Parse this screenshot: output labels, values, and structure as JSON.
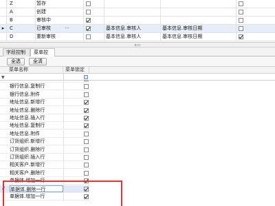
{
  "top_grid": {
    "rows": [
      {
        "code": "Z",
        "name": "暂存",
        "chk1": false,
        "f1": "",
        "f2": "",
        "chk2": false,
        "indicator": "",
        "selected": false
      },
      {
        "code": "A",
        "name": "创建",
        "chk1": false,
        "f1": "",
        "f2": "",
        "chk2": false,
        "indicator": "",
        "selected": false
      },
      {
        "code": "B",
        "name": "审核中",
        "chk1": true,
        "f1": "",
        "f2": "",
        "chk2": false,
        "indicator": "",
        "selected": false
      },
      {
        "code": "C",
        "name": "已审核",
        "chk1": true,
        "f1": "基本信息.审核人",
        "f2": "基本信息.审核日期",
        "chk2": false,
        "indicator": "▸",
        "selected": true,
        "dots": "···"
      },
      {
        "code": "D",
        "name": "重新审核",
        "chk1": false,
        "f1": "基本信息.审核人",
        "f2": "基本信息.审核日期",
        "chk2": true,
        "indicator": "",
        "selected": false
      }
    ]
  },
  "tabs": [
    {
      "label": "字段控制"
    },
    {
      "label": "菜单控制"
    }
  ],
  "toolbar": {
    "select_all": "全选",
    "clear_all": "全清"
  },
  "lower_grid": {
    "headers": {
      "name": "菜单名称",
      "lock": "菜单锁定"
    },
    "filter_icon": "▼",
    "rows": [
      {
        "name": "",
        "lock": true,
        "indicator": ""
      },
      {
        "name": "银行信息.复制行",
        "lock": false,
        "indicator": ""
      },
      {
        "name": "银行信息.附件",
        "lock": false,
        "indicator": ""
      },
      {
        "name": "地址信息.新增行",
        "lock": true,
        "indicator": ""
      },
      {
        "name": "地址信息.删除行",
        "lock": true,
        "indicator": ""
      },
      {
        "name": "地址信息.插入行",
        "lock": true,
        "indicator": ""
      },
      {
        "name": "地址信息.复制行",
        "lock": true,
        "indicator": ""
      },
      {
        "name": "地址信息.附件",
        "lock": false,
        "indicator": ""
      },
      {
        "name": "订货组织.新增行",
        "lock": false,
        "indicator": ""
      },
      {
        "name": "订货组织.删除行",
        "lock": false,
        "indicator": ""
      },
      {
        "name": "订货组织.插入行",
        "lock": false,
        "indicator": ""
      },
      {
        "name": "相关客户.新增行",
        "lock": false,
        "indicator": ""
      },
      {
        "name": "相关客户.删除行",
        "lock": false,
        "indicator": ""
      },
      {
        "name": "单据体.增加一行",
        "lock": true,
        "indicator": ""
      },
      {
        "name": "单据体.删除一行",
        "lock": true,
        "indicator": "//",
        "selected": true
      },
      {
        "name": "单据体.增加一行",
        "lock": true,
        "indicator": ""
      }
    ]
  },
  "colors": {
    "highlight": "#e03030",
    "selection": "#dfe9f7"
  }
}
